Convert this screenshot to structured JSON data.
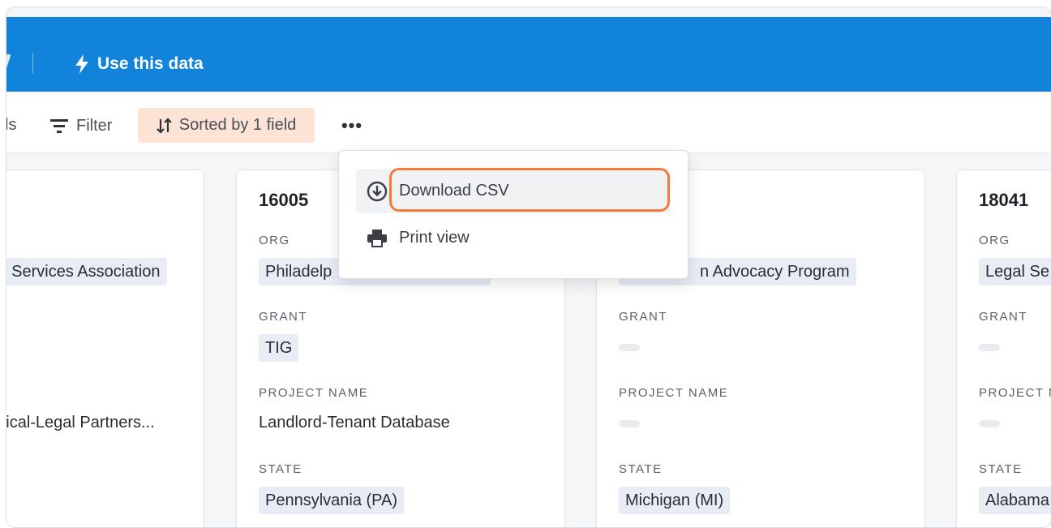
{
  "topbar": {
    "use_data_label": "Use this data",
    "accent": "#1283da"
  },
  "toolbar": {
    "fields_label_partial": "ls",
    "filter_label": "Filter",
    "sort_label": "Sorted by 1 field",
    "more_label": "•••"
  },
  "menu": {
    "items": [
      {
        "label": "Download CSV",
        "icon": "download-icon"
      },
      {
        "label": "Print view",
        "icon": "printer-icon"
      }
    ],
    "highlight_color": "#f37a3a"
  },
  "labels": {
    "org": "ORG",
    "grant": "GRANT",
    "project_name": "PROJECT NAME",
    "state": "STATE"
  },
  "cards": [
    {
      "id": "",
      "org": "al Services Association",
      "grant": "",
      "project_name": "edical-Legal Partners...",
      "state": ")"
    },
    {
      "id": "16005",
      "org": "Philadelp",
      "grant": "TIG",
      "project_name": "Landlord-Tenant Database",
      "state": "Pennsylvania (PA)"
    },
    {
      "id": "",
      "org": "n Advocacy Program",
      "grant": "",
      "project_name": "",
      "state": "Michigan (MI)"
    },
    {
      "id": "18041",
      "org": "Legal Se",
      "grant": "",
      "project_name": "",
      "state": "Alabama"
    }
  ]
}
